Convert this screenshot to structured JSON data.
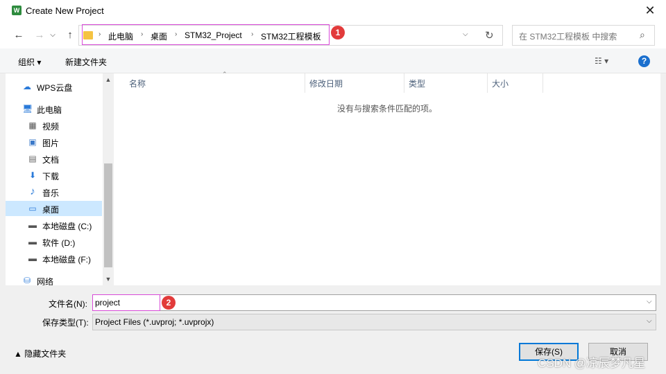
{
  "window": {
    "title": "Create New Project",
    "app_icon_letter": "W"
  },
  "nav": {
    "back": "←",
    "forward": "→",
    "up": "↑",
    "dropdown": "⌵",
    "refresh": "↻"
  },
  "breadcrumb": [
    "此电脑",
    "桌面",
    "STM32_Project",
    "STM32工程模板"
  ],
  "search": {
    "placeholder": "在 STM32工程模板 中搜索"
  },
  "toolbar": {
    "organize": "组织 ▾",
    "new_folder": "新建文件夹",
    "view": "☷ ▾",
    "help": "?"
  },
  "sidebar": {
    "items": [
      {
        "label": "WPS云盘",
        "icon": "cloud-icon",
        "glyph": "☁"
      },
      {
        "label": "此电脑",
        "icon": "computer-icon",
        "glyph": "🖥"
      },
      {
        "label": "视频",
        "icon": "video-icon",
        "glyph": "▦"
      },
      {
        "label": "图片",
        "icon": "picture-icon",
        "glyph": "▣"
      },
      {
        "label": "文档",
        "icon": "document-icon",
        "glyph": "▤"
      },
      {
        "label": "下载",
        "icon": "download-icon",
        "glyph": "⬇"
      },
      {
        "label": "音乐",
        "icon": "music-icon",
        "glyph": "♪"
      },
      {
        "label": "桌面",
        "icon": "desktop-icon",
        "glyph": "▭"
      },
      {
        "label": "本地磁盘 (C:)",
        "icon": "drive-icon",
        "glyph": "▬"
      },
      {
        "label": "软件 (D:)",
        "icon": "drive-icon",
        "glyph": "▬"
      },
      {
        "label": "本地磁盘 (F:)",
        "icon": "drive-icon",
        "glyph": "▬"
      },
      {
        "label": "网络",
        "icon": "network-icon",
        "glyph": "⛁"
      }
    ],
    "selected": "桌面"
  },
  "columns": [
    "名称",
    "修改日期",
    "类型",
    "大小"
  ],
  "empty_message": "没有与搜索条件匹配的项。",
  "filename": {
    "label": "文件名(N):",
    "value": "project"
  },
  "filetype": {
    "label": "保存类型(T):",
    "value": "Project Files (*.uvproj; *.uvprojx)"
  },
  "hide_folders": "▲ 隐藏文件夹",
  "buttons": {
    "save": "保存(S)",
    "cancel": "取消"
  },
  "annotations": {
    "badge1": "1",
    "badge2": "2"
  },
  "watermark": "CSDN @凉辰梦凡星",
  "colors": {
    "highlight": "#d84ad8",
    "badge": "#e23b3b",
    "selected": "#cce8ff",
    "accent": "#0078d7"
  }
}
